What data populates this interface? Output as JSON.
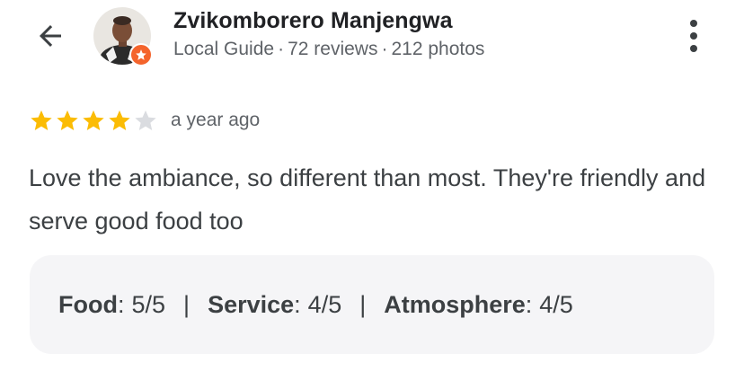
{
  "header": {
    "back_icon": "arrow-back-icon",
    "more_icon": "more-vert-icon"
  },
  "user": {
    "name": "Zvikomborero Manjengwa",
    "badge_icon": "local-guide-star-icon",
    "badge_color": "#f4642c",
    "role": "Local Guide",
    "reviews": "72 reviews",
    "photos": "212 photos",
    "separator": "·"
  },
  "review": {
    "rating": 4,
    "max_rating": 5,
    "star_color": "#fbbc04",
    "empty_star_color": "#dadce0",
    "time": "a year ago",
    "text": "Love the ambiance, so different than most. They're friendly and serve good food too"
  },
  "attributes": [
    {
      "name": "Food",
      "value": "5/5"
    },
    {
      "name": "Service",
      "value": "4/5"
    },
    {
      "name": "Atmosphere",
      "value": "4/5"
    }
  ],
  "attribute_separator": "|",
  "attribute_colon": ":"
}
